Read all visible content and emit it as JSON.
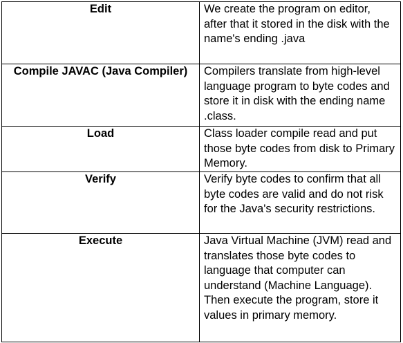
{
  "table": {
    "rows": [
      {
        "phase": "Edit",
        "description": "We create the program on editor, after that it stored in the disk with the name's ending .java"
      },
      {
        "phase": "Compile JAVAC (Java Compiler)",
        "description": "Compilers translate from high-level language program to byte codes and store it in disk with the ending name .class."
      },
      {
        "phase": "Load",
        "description": "Class loader compile read and put those byte codes from disk to Primary Memory."
      },
      {
        "phase": "Verify",
        "description": "Verify byte codes to confirm that all byte codes are valid and do not risk for the Java's security restrictions."
      },
      {
        "phase": "Execute",
        "description": "Java Virtual Machine (JVM) read and translates those byte codes to language that computer can understand (Machine Language). Then execute the program, store it values in primary memory."
      }
    ]
  }
}
